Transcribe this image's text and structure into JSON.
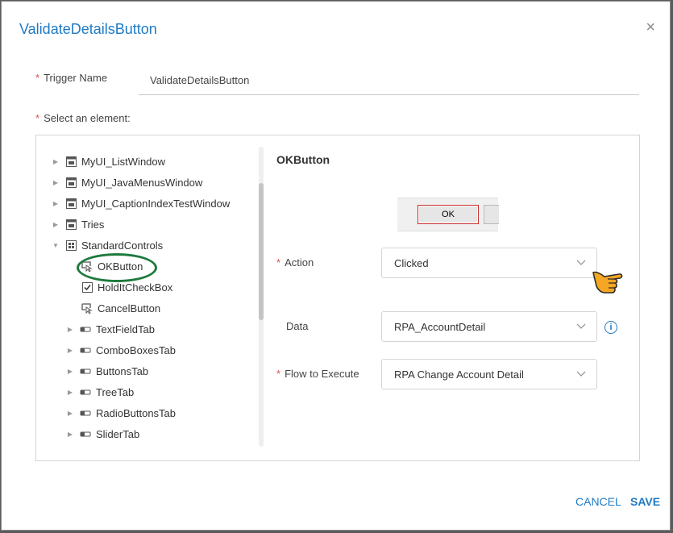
{
  "dialog": {
    "title": "ValidateDetailsButton",
    "close_glyph": "×"
  },
  "trigger": {
    "required_mark": "*",
    "label": "Trigger Name",
    "value": "ValidateDetailsButton"
  },
  "element": {
    "required_mark": "*",
    "label": "Select an element:"
  },
  "tree": {
    "items": [
      {
        "label": "MyUI_ListWindow",
        "icon": "window-icon",
        "expandable": true
      },
      {
        "label": "MyUI_JavaMenusWindow",
        "icon": "window-icon",
        "expandable": true
      },
      {
        "label": "MyUI_CaptionIndexTestWindow",
        "icon": "window-icon",
        "expandable": true
      },
      {
        "label": "Tries",
        "icon": "window-icon",
        "expandable": true
      },
      {
        "label": "StandardControls",
        "icon": "grid-icon",
        "expanded": true
      },
      {
        "label": "OKButton",
        "icon": "button-cursor-icon",
        "selected": true
      },
      {
        "label": "HoldItCheckBox",
        "icon": "checkbox-icon"
      },
      {
        "label": "CancelButton",
        "icon": "button-cursor-icon"
      },
      {
        "label": "TextFieldTab",
        "icon": "tab-icon",
        "expandable": true
      },
      {
        "label": "ComboBoxesTab",
        "icon": "tab-icon",
        "expandable": true
      },
      {
        "label": "ButtonsTab",
        "icon": "tab-icon",
        "expandable": true
      },
      {
        "label": "TreeTab",
        "icon": "tab-icon",
        "expandable": true
      },
      {
        "label": "RadioButtonsTab",
        "icon": "tab-icon",
        "expandable": true
      },
      {
        "label": "SliderTab",
        "icon": "tab-icon",
        "expandable": true
      }
    ]
  },
  "details": {
    "title": "OKButton",
    "preview_button": "OK",
    "action": {
      "required_mark": "*",
      "label": "Action",
      "value": "Clicked"
    },
    "data": {
      "label": "Data",
      "value": "RPA_AccountDetail",
      "info_glyph": "i"
    },
    "flow": {
      "required_mark": "*",
      "label": "Flow to Execute",
      "value": "RPA Change Account Detail"
    }
  },
  "footer": {
    "cancel_label": "CANCEL",
    "save_label": "SAVE"
  },
  "colors": {
    "accent": "#1f7ac4",
    "required": "#d9534f",
    "highlight_ring": "#1e7a3c",
    "pointer_hand": "#f5a623"
  }
}
